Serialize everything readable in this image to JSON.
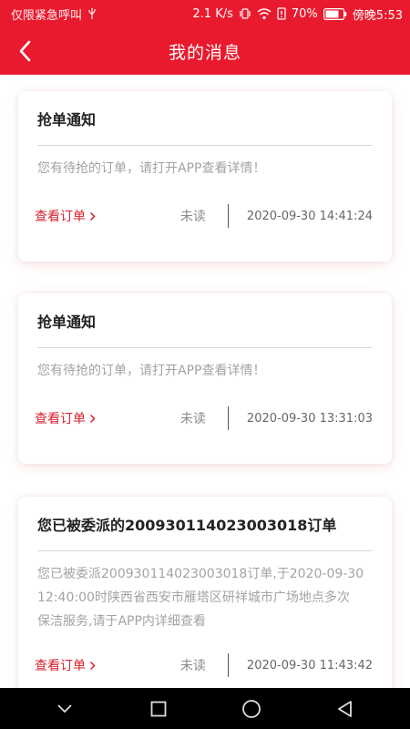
{
  "status_bar": {
    "carrier": "仅限紧急呼叫",
    "speed": "2.1 K/s",
    "battery": "70%",
    "time": "傍晚5:53"
  },
  "header": {
    "title": "我的消息",
    "background": "#ea1a2e"
  },
  "messages": [
    {
      "title": "抢单通知",
      "body": "您有待抢的订单，请打开APP查看详情！",
      "link_label": "查看订单",
      "status": "未读",
      "time": "2020-09-30 14:41:24"
    },
    {
      "title": "抢单通知",
      "body": "您有待抢的订单，请打开APP查看详情！",
      "link_label": "查看订单",
      "status": "未读",
      "time": "2020-09-30 13:31:03"
    },
    {
      "title": "您已被委派的200930114023003018订单",
      "body_lines": [
        "您已被委派200930114023003018订单,于2020-09-30",
        "12:40:00时陕西省西安市雁塔区研祥城市广场地点多次",
        "保洁服务,请于APP内详细查看"
      ],
      "link_label": "查看订单",
      "status": "未读",
      "time": "2020-09-30 11:43:42"
    }
  ],
  "colors": {
    "accent": "#ea1a2e",
    "link": "#d7202e"
  },
  "icons": {
    "back": "chevron-left-icon",
    "link_chevron": "chevron-right-icon",
    "nav": [
      "chevron-down-icon",
      "square-icon",
      "circle-icon",
      "triangle-back-icon"
    ]
  }
}
